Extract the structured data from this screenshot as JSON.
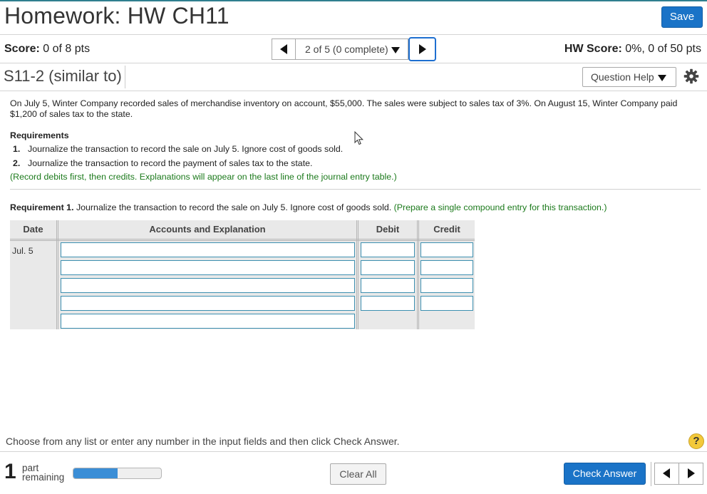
{
  "header": {
    "title": "Homework: HW CH11",
    "save_label": "Save"
  },
  "status_bar": {
    "score_label": "Score:",
    "score_value": " 0 of 8 pts",
    "nav_text": "2 of 5 (0 complete)",
    "hw_score_label": "HW Score:",
    "hw_score_value": " 0%, 0 of 50 pts"
  },
  "question": {
    "title": "S11-2 (similar to)",
    "help_label": "Question Help",
    "problem_text": "On July 5, Winter Company recorded sales of merchandise inventory on account, $55,000. The sales were subject to sales tax of 3%. On August 15, Winter Company paid $1,200 of sales tax to the state.",
    "requirements_heading": "Requirements",
    "requirements": [
      {
        "num": "1.",
        "text": "Journalize the transaction to record the sale on July 5. Ignore cost of goods sold."
      },
      {
        "num": "2.",
        "text": "Journalize the transaction to record the payment of sales tax to the state."
      }
    ],
    "note": "(Record debits first, then credits. Explanations will appear on the last line of the journal entry table.)",
    "req1_bold": "Requirement 1.",
    "req1_text": " Journalize the transaction to record the sale on July 5. Ignore cost of goods sold. ",
    "req1_green": "(Prepare a single compound entry for this transaction.)"
  },
  "journal": {
    "headers": {
      "date": "Date",
      "accounts": "Accounts and Explanation",
      "debit": "Debit",
      "credit": "Credit"
    },
    "date": "Jul. 5",
    "rows": [
      {
        "account": "",
        "debit": "",
        "credit": ""
      },
      {
        "account": "",
        "debit": "",
        "credit": ""
      },
      {
        "account": "",
        "debit": "",
        "credit": ""
      },
      {
        "account": "",
        "debit": "",
        "credit": ""
      }
    ],
    "explanation": ""
  },
  "footer": {
    "hint": "Choose from any list or enter any number in the input fields and then click Check Answer.",
    "help_glyph": "?",
    "parts_count": "1",
    "parts_label_1": "part",
    "parts_label_2": "remaining",
    "progress_fraction": 0.5,
    "clear_label": "Clear All",
    "check_label": "Check Answer"
  },
  "colors": {
    "accent": "#1a73c7",
    "green_text": "#1c7a1c",
    "progress": "#3b8ed6"
  },
  "icons": {
    "prev": "triangle-left-icon",
    "next": "triangle-right-icon",
    "dropdown": "caret-down-icon",
    "settings": "gear-icon",
    "help": "question-circle-icon"
  }
}
